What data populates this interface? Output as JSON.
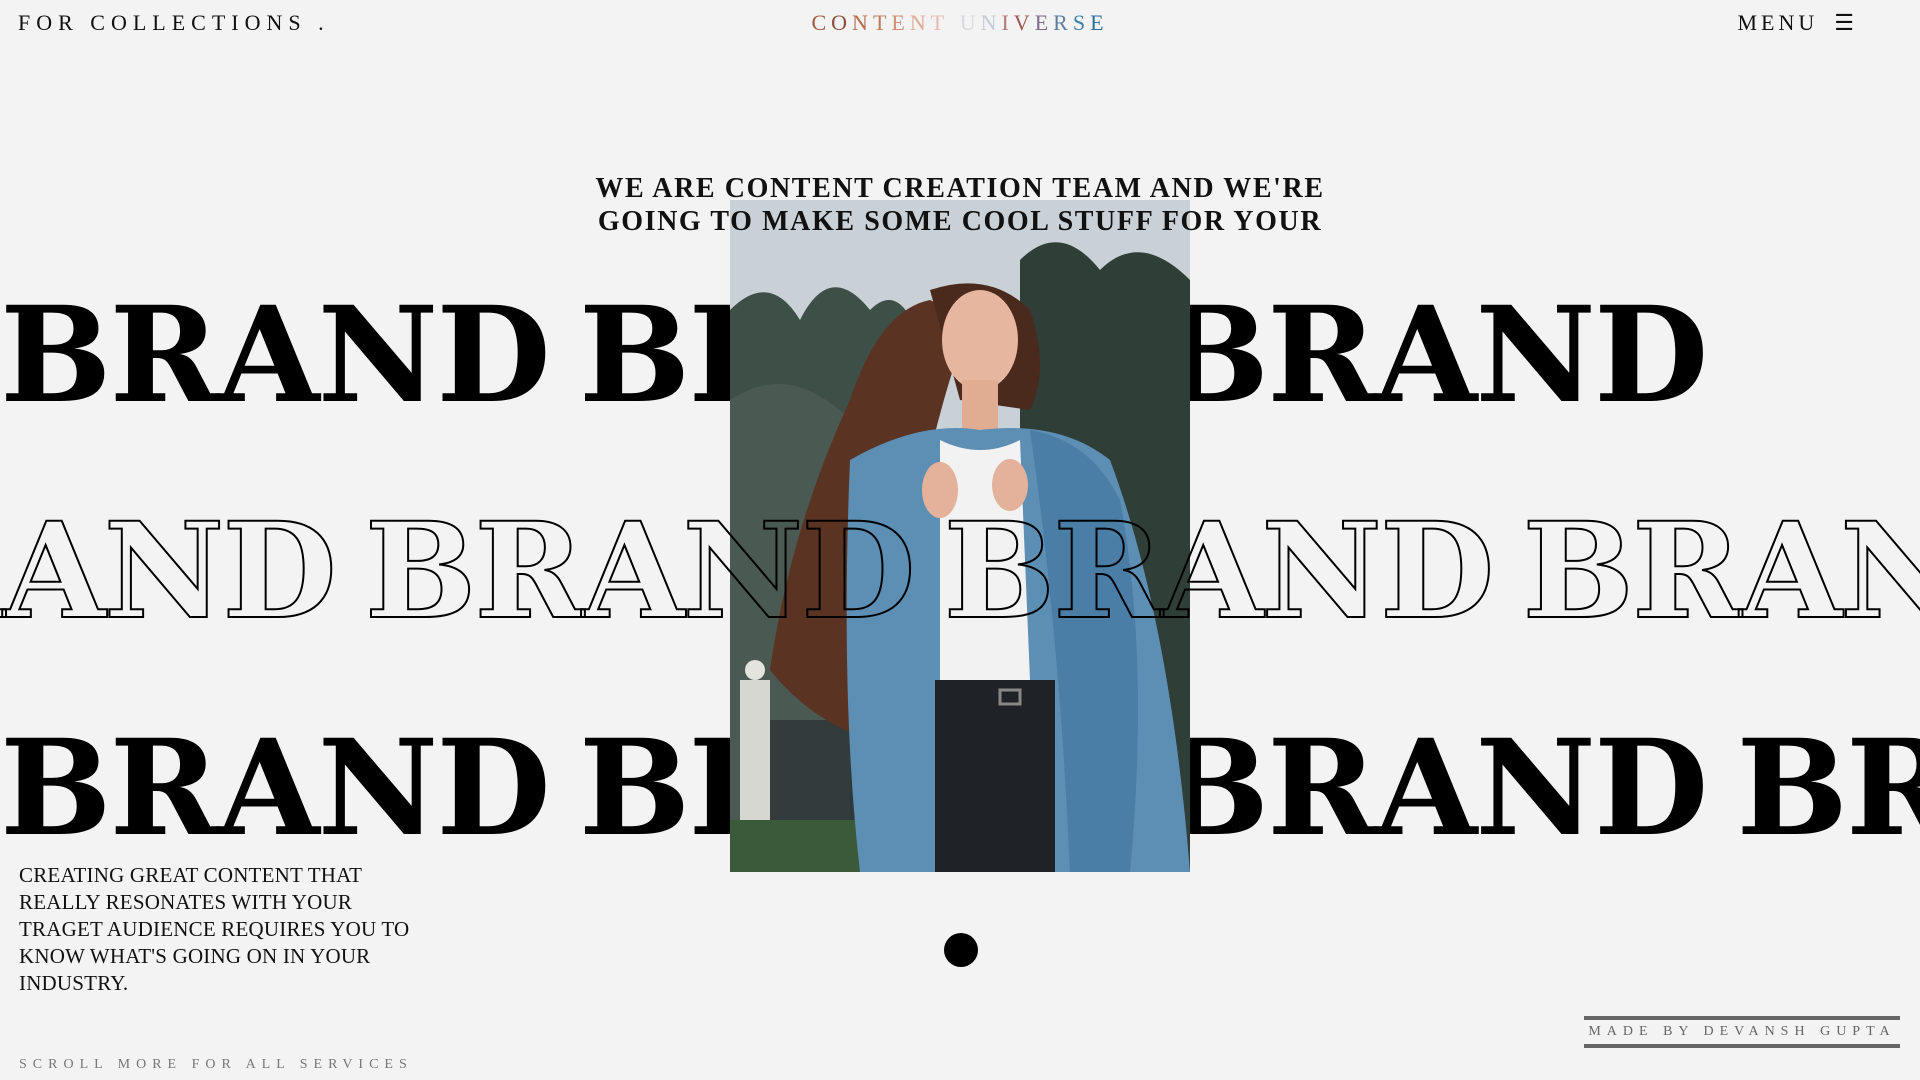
{
  "header": {
    "left_link": "FOR COLLECTIONS .",
    "logo_letters": [
      {
        "ch": "C",
        "color": "#a15a3e"
      },
      {
        "ch": "O",
        "color": "#8c4d3a"
      },
      {
        "ch": "N",
        "color": "#b86a4a"
      },
      {
        "ch": "T",
        "color": "#c27a5c"
      },
      {
        "ch": "E",
        "color": "#d18f77"
      },
      {
        "ch": "N",
        "color": "#e0a896"
      },
      {
        "ch": "T",
        "color": "#e6bcae"
      },
      {
        "ch": " ",
        "color": "#ffffff"
      },
      {
        "ch": "U",
        "color": "#d8d8e0"
      },
      {
        "ch": "N",
        "color": "#c7cad6"
      },
      {
        "ch": "I",
        "color": "#b37a7a"
      },
      {
        "ch": "V",
        "color": "#9e5b55"
      },
      {
        "ch": "E",
        "color": "#7f6a8a"
      },
      {
        "ch": "R",
        "color": "#5e7fa0"
      },
      {
        "ch": "S",
        "color": "#3f7ea8"
      },
      {
        "ch": "E",
        "color": "#2e6f9e"
      }
    ],
    "menu_label": "MENU",
    "menu_icon": "☰"
  },
  "intro": {
    "line1": "WE ARE CONTENT CREATION TEAM AND WE'RE",
    "line2": "GOING TO MAKE SOME COOL STUFF FOR YOUR"
  },
  "brand_word": "BRAND",
  "photo": {
    "subject": "woman with long hair in denim jacket"
  },
  "description": "CREATING GREAT CONTENT THAT REALLY RESONATES WITH YOUR TRAGET AUDIENCE REQUIRES YOU TO KNOW WHAT'S GOING ON IN YOUR INDUSTRY.",
  "scroll_hint": "SCROLL MORE FOR ALL SERVICES",
  "credit": "MADE BY DEVANSH GUPTA"
}
